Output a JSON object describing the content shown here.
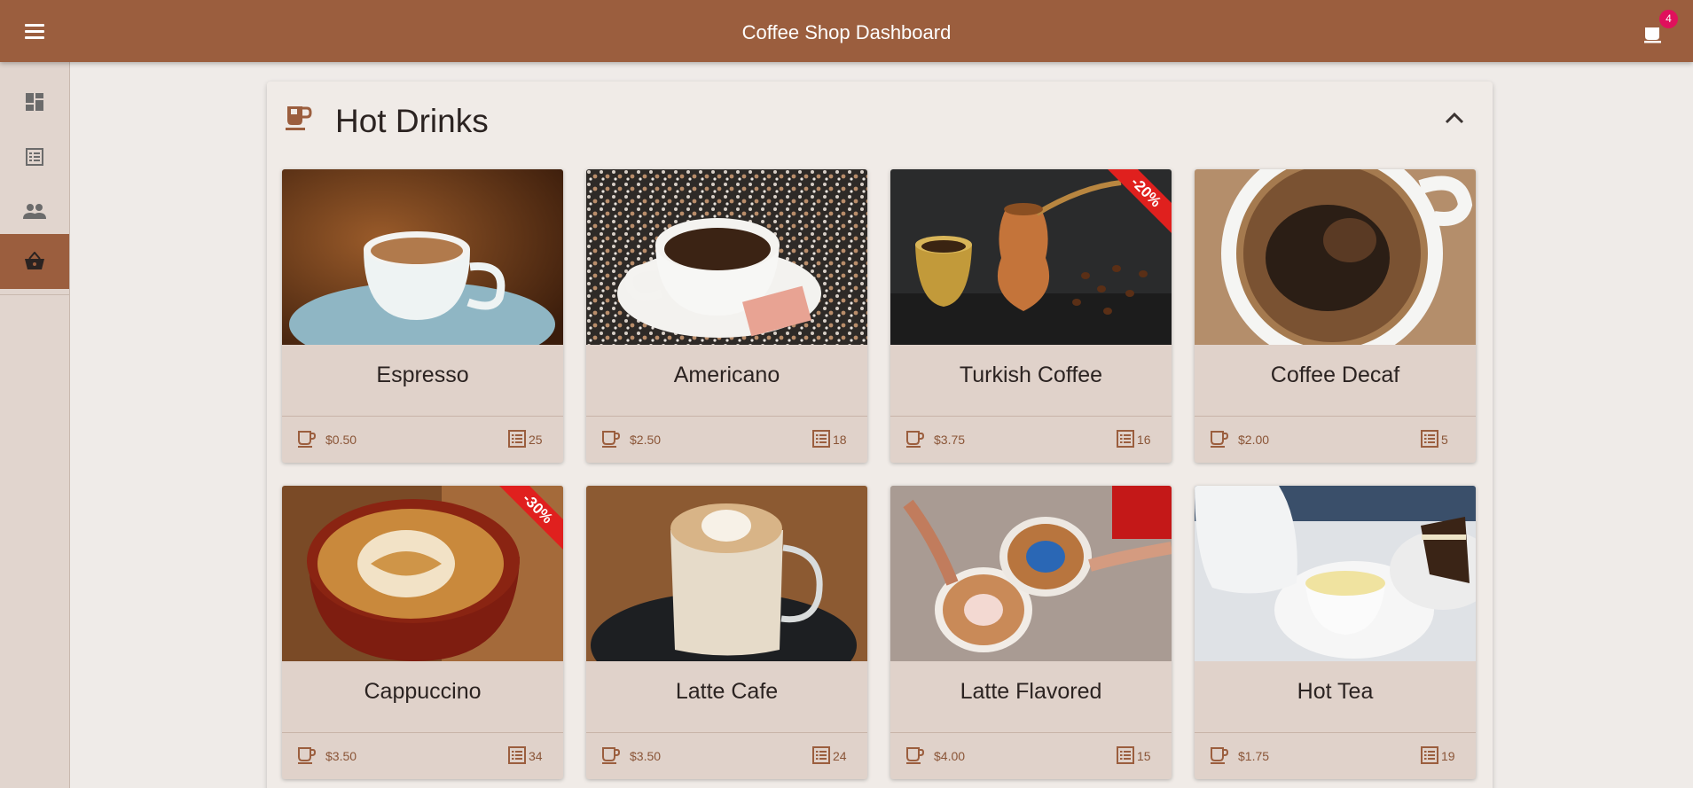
{
  "app": {
    "title": "Coffee Shop Dashboard",
    "cart_count": "4"
  },
  "colors": {
    "primary": "#9b5e3e",
    "sidebar": "#e1d5ce",
    "card": "#e0d2ca",
    "badge": "#e0105c",
    "ribbon": "#e0201e"
  },
  "sidebar": {
    "items": [
      {
        "icon": "dashboard-icon",
        "active": false
      },
      {
        "icon": "list-icon",
        "active": false
      },
      {
        "icon": "people-icon",
        "active": false
      },
      {
        "icon": "basket-icon",
        "active": true
      }
    ]
  },
  "section": {
    "title": "Hot Drinks",
    "icon": "coffee-cup-icon"
  },
  "products": [
    {
      "name": "Espresso",
      "price": "$0.50",
      "stock": "25",
      "discount": ""
    },
    {
      "name": "Americano",
      "price": "$2.50",
      "stock": "18",
      "discount": ""
    },
    {
      "name": "Turkish Coffee",
      "price": "$3.75",
      "stock": "16",
      "discount": "-20%"
    },
    {
      "name": "Coffee Decaf",
      "price": "$2.00",
      "stock": "5",
      "discount": ""
    },
    {
      "name": "Cappuccino",
      "price": "$3.50",
      "stock": "34",
      "discount": "-30%"
    },
    {
      "name": "Latte Cafe",
      "price": "$3.50",
      "stock": "24",
      "discount": ""
    },
    {
      "name": "Latte Flavored",
      "price": "$4.00",
      "stock": "15",
      "discount": ""
    },
    {
      "name": "Hot Tea",
      "price": "$1.75",
      "stock": "19",
      "discount": ""
    }
  ]
}
